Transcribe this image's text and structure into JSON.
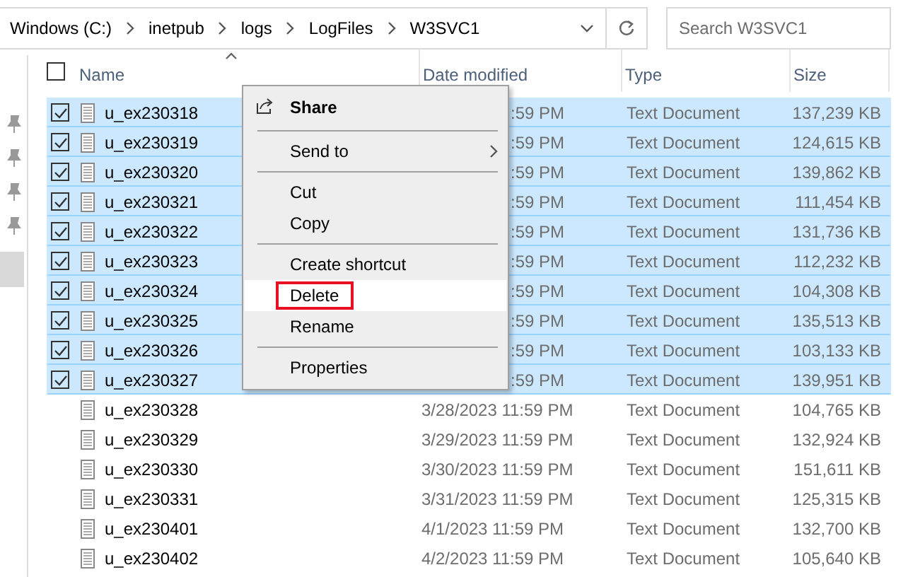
{
  "address": {
    "segments": [
      "Windows (C:)",
      "inetpub",
      "logs",
      "LogFiles",
      "W3SVC1"
    ]
  },
  "search": {
    "placeholder": "Search W3SVC1"
  },
  "header_checkbox": {
    "checked": false
  },
  "columns": [
    {
      "label": "Name",
      "sorted": true
    },
    {
      "label": "Date modified",
      "sorted": false
    },
    {
      "label": "Type",
      "sorted": false
    },
    {
      "label": "Size",
      "sorted": false
    }
  ],
  "rows": [
    {
      "name": "u_ex230318",
      "date": ":59 PM",
      "type": "Text Document",
      "size": "137,239 KB",
      "selected": true,
      "covered": true
    },
    {
      "name": "u_ex230319",
      "date": ":59 PM",
      "type": "Text Document",
      "size": "124,615 KB",
      "selected": true,
      "covered": true
    },
    {
      "name": "u_ex230320",
      "date": ":59 PM",
      "type": "Text Document",
      "size": "139,862 KB",
      "selected": true,
      "covered": true
    },
    {
      "name": "u_ex230321",
      "date": ":59 PM",
      "type": "Text Document",
      "size": "111,454 KB",
      "selected": true,
      "covered": true
    },
    {
      "name": "u_ex230322",
      "date": ":59 PM",
      "type": "Text Document",
      "size": "131,736 KB",
      "selected": true,
      "covered": true
    },
    {
      "name": "u_ex230323",
      "date": ":59 PM",
      "type": "Text Document",
      "size": "112,232 KB",
      "selected": true,
      "covered": true
    },
    {
      "name": "u_ex230324",
      "date": ":59 PM",
      "type": "Text Document",
      "size": "104,308 KB",
      "selected": true,
      "covered": true
    },
    {
      "name": "u_ex230325",
      "date": ":59 PM",
      "type": "Text Document",
      "size": "135,513 KB",
      "selected": true,
      "covered": true
    },
    {
      "name": "u_ex230326",
      "date": ":59 PM",
      "type": "Text Document",
      "size": "103,133 KB",
      "selected": true,
      "covered": true
    },
    {
      "name": "u_ex230327",
      "date": ":59 PM",
      "type": "Text Document",
      "size": "139,951 KB",
      "selected": true,
      "covered": true
    },
    {
      "name": "u_ex230328",
      "date": "3/28/2023 11:59 PM",
      "type": "Text Document",
      "size": "104,765 KB",
      "selected": false,
      "covered": false
    },
    {
      "name": "u_ex230329",
      "date": "3/29/2023 11:59 PM",
      "type": "Text Document",
      "size": "132,924 KB",
      "selected": false,
      "covered": false
    },
    {
      "name": "u_ex230330",
      "date": "3/30/2023 11:59 PM",
      "type": "Text Document",
      "size": "151,611 KB",
      "selected": false,
      "covered": false
    },
    {
      "name": "u_ex230331",
      "date": "3/31/2023 11:59 PM",
      "type": "Text Document",
      "size": "125,315 KB",
      "selected": false,
      "covered": false
    },
    {
      "name": "u_ex230401",
      "date": "4/1/2023 11:59 PM",
      "type": "Text Document",
      "size": "132,700 KB",
      "selected": false,
      "covered": false
    },
    {
      "name": "u_ex230402",
      "date": "4/2/2023 11:59 PM",
      "type": "Text Document",
      "size": "105,640 KB",
      "selected": false,
      "covered": false
    }
  ],
  "context_menu": {
    "items": [
      {
        "kind": "item",
        "label": "Share",
        "bold": true,
        "icon": true,
        "submenu": false,
        "hovered": false,
        "outlined": false
      },
      {
        "kind": "separator"
      },
      {
        "kind": "item",
        "label": "Send to",
        "bold": false,
        "icon": false,
        "submenu": true,
        "hovered": false,
        "outlined": false
      },
      {
        "kind": "separator"
      },
      {
        "kind": "item",
        "label": "Cut",
        "bold": false,
        "icon": false,
        "submenu": false,
        "hovered": false,
        "outlined": false
      },
      {
        "kind": "item",
        "label": "Copy",
        "bold": false,
        "icon": false,
        "submenu": false,
        "hovered": false,
        "outlined": false
      },
      {
        "kind": "separator"
      },
      {
        "kind": "item",
        "label": "Create shortcut",
        "bold": false,
        "icon": false,
        "submenu": false,
        "hovered": false,
        "outlined": false
      },
      {
        "kind": "item",
        "label": "Delete",
        "bold": false,
        "icon": false,
        "submenu": false,
        "hovered": true,
        "outlined": true
      },
      {
        "kind": "item",
        "label": "Rename",
        "bold": false,
        "icon": false,
        "submenu": false,
        "hovered": false,
        "outlined": false
      },
      {
        "kind": "separator"
      },
      {
        "kind": "item",
        "label": "Properties",
        "bold": false,
        "icon": false,
        "submenu": false,
        "hovered": false,
        "outlined": false
      }
    ]
  }
}
